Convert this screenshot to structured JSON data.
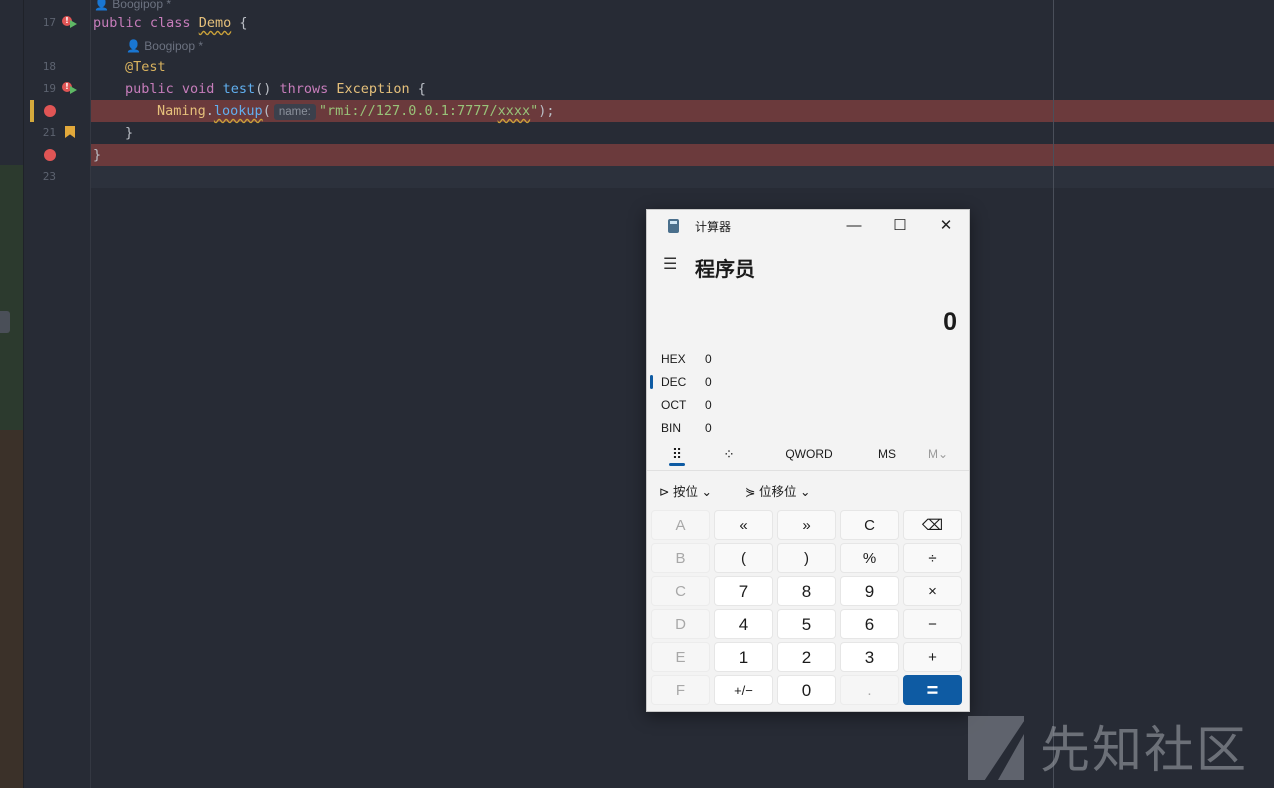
{
  "editor": {
    "lines": [
      {
        "no": "17",
        "text": ""
      },
      {
        "no": "18",
        "text": ""
      },
      {
        "no": "19",
        "text": ""
      },
      {
        "no": "21",
        "text": ""
      },
      {
        "no": "23",
        "text": ""
      }
    ],
    "author_top": "Boogipop *",
    "author_mid": "Boogipop *",
    "code": {
      "l17_kw1": "public",
      "l17_kw2": "class",
      "l17_cls": "Demo",
      "l17_brace": "{",
      "l18_ann": "@Test",
      "l19_kw1": "public",
      "l19_kw2": "void",
      "l19_fn": "test",
      "l19_paren": "()",
      "l19_kw3": "throws",
      "l19_cls": "Exception",
      "l19_brace": "{",
      "l20_cls": "Naming",
      "l20_dot": ".",
      "l20_fn": "lookup",
      "l20_open": "(",
      "l20_hint": "name:",
      "l20_str_a": "\"rmi://127.0.0.1:7777/",
      "l20_str_b": "xxxx",
      "l20_str_c": "\"",
      "l20_close": ");",
      "l21_brace": "}",
      "l22_brace": "}"
    }
  },
  "calculator": {
    "title": "计算器",
    "mode": "程序员",
    "display": "0",
    "bases": [
      {
        "label": "HEX",
        "value": "0"
      },
      {
        "label": "DEC",
        "value": "0"
      },
      {
        "label": "OCT",
        "value": "0"
      },
      {
        "label": "BIN",
        "value": "0"
      }
    ],
    "word_size": "QWORD",
    "ms": "MS",
    "m": "M",
    "bitwise": "按位",
    "bitshift": "位移位",
    "window_buttons": {
      "minimize": "—",
      "maximize": "☐",
      "close": "✕"
    },
    "keys": [
      [
        "A",
        "«",
        "»",
        "C",
        "⌫"
      ],
      [
        "B",
        "(",
        ")",
        "%",
        "÷"
      ],
      [
        "C",
        "7",
        "8",
        "9",
        "×"
      ],
      [
        "D",
        "4",
        "5",
        "6",
        "−"
      ],
      [
        "E",
        "1",
        "2",
        "3",
        "+"
      ],
      [
        "F",
        "+/−",
        "0",
        ".",
        "="
      ]
    ]
  },
  "watermark": "先知社区"
}
